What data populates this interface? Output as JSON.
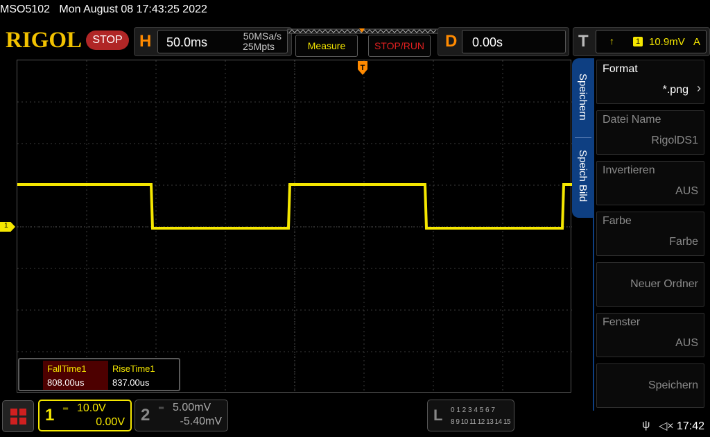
{
  "header": {
    "model": "MSO5102",
    "datetime": "Mon August 08 17:43:25 2022",
    "logo": "RIGOL",
    "run_state": "STOP"
  },
  "horizontal": {
    "letter": "H",
    "timebase": "50.0ms",
    "sample_rate": "50MSa/s",
    "memory_depth": "25Mpts"
  },
  "buttons": {
    "measure": "Measure",
    "stop_run": "STOP/RUN"
  },
  "delay": {
    "letter": "D",
    "value": "0.00s"
  },
  "trigger": {
    "letter": "T",
    "source": "1",
    "level": "10.9mV",
    "mode": "A",
    "marker": "T"
  },
  "channel1_marker": "1",
  "measurements": {
    "items": [
      {
        "label": "FallTime1",
        "value": "808.00us"
      },
      {
        "label": "RiseTime1",
        "value": "837.00us"
      }
    ]
  },
  "side_tabs": {
    "tab1": "Speichern",
    "tab2": "Speich Bild"
  },
  "menu": {
    "items": [
      {
        "label": "Format",
        "value": "*.png"
      },
      {
        "label": "Datei Name",
        "value": "RigolDS1"
      },
      {
        "label": "Invertieren",
        "value": "AUS"
      },
      {
        "label": "Farbe",
        "value": "Farbe"
      },
      {
        "label": "",
        "value": "Neuer Ordner"
      },
      {
        "label": "Fenster",
        "value": "AUS"
      },
      {
        "label": "",
        "value": "Speichern"
      }
    ]
  },
  "ch1": {
    "number": "1",
    "scale": "10.0V",
    "offset": "0.00V",
    "color": "#f5e700"
  },
  "ch2": {
    "number": "2",
    "scale": "5.00mV",
    "offset": "-5.40mV"
  },
  "la": {
    "letter": "L",
    "row1": "0 1 2 3  4 5 6 7",
    "row2": "8 9 10 11 12 13 14 15"
  },
  "status": {
    "time": "17:42"
  },
  "colors": {
    "trace": "#f5e700",
    "accent_orange": "#ff8a00",
    "stop_red": "#b02626",
    "panel_blue": "#0e3f82"
  }
}
